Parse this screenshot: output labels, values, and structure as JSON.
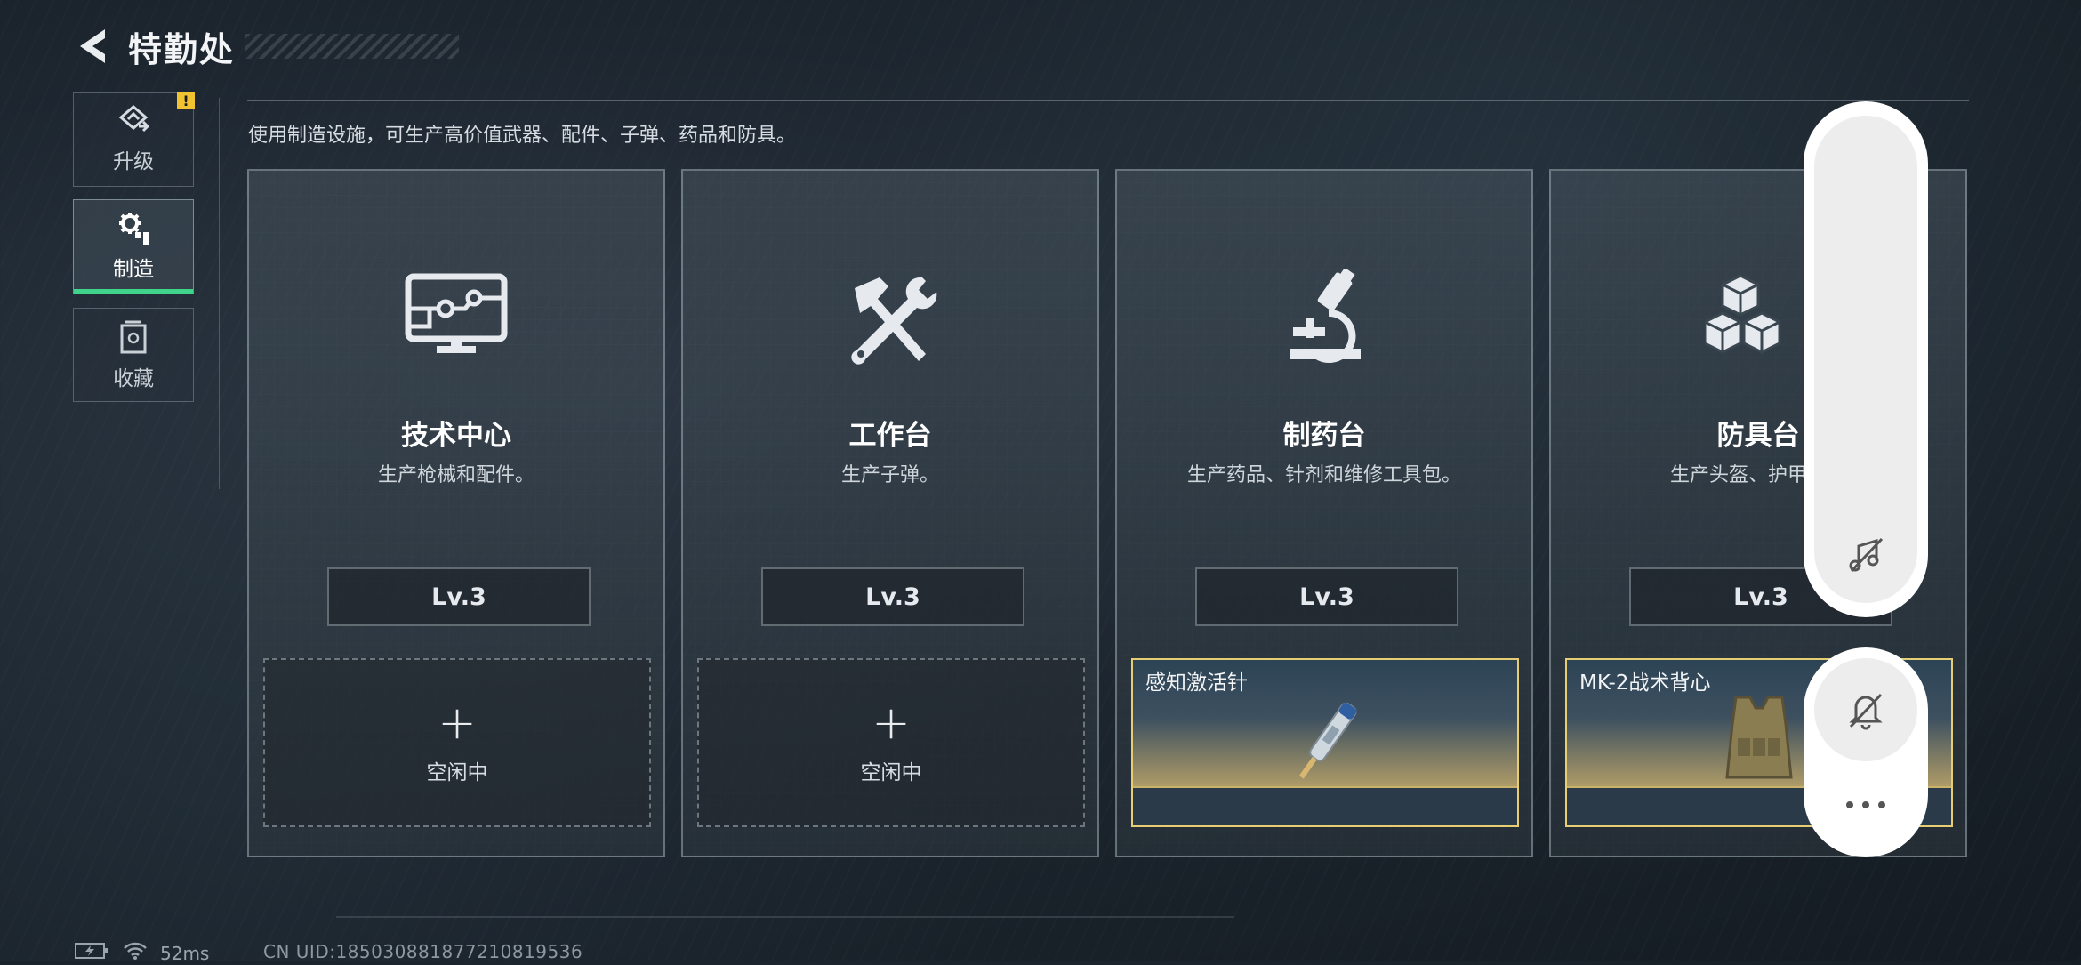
{
  "header": {
    "title": "特勤处"
  },
  "sidebar": {
    "items": [
      {
        "label": "升级",
        "icon": "upgrade-icon",
        "active": false,
        "badge": "!"
      },
      {
        "label": "制造",
        "icon": "manufacture-gear-icon",
        "active": true
      },
      {
        "label": "收藏",
        "icon": "collection-icon",
        "active": false
      }
    ]
  },
  "description": "使用制造设施，可生产高价值武器、配件、子弹、药品和防具。",
  "cards": [
    {
      "name": "技术中心",
      "sub": "生产枪械和配件。",
      "level": "Lv.3",
      "icon": "monitor-circuit-icon",
      "slot": {
        "type": "empty",
        "label": "空闲中"
      }
    },
    {
      "name": "工作台",
      "sub": "生产子弹。",
      "level": "Lv.3",
      "icon": "hammer-wrench-icon",
      "slot": {
        "type": "empty",
        "label": "空闲中"
      }
    },
    {
      "name": "制药台",
      "sub": "生产药品、针剂和维修工具包。",
      "level": "Lv.3",
      "icon": "microscope-icon",
      "slot": {
        "type": "item",
        "name": "感知激活针"
      }
    },
    {
      "name": "防具台",
      "sub": "生产头盔、护甲、胸",
      "level": "Lv.3",
      "icon": "cubes-icon",
      "slot": {
        "type": "item",
        "name": "MK-2战术背心"
      }
    }
  ],
  "status": {
    "ping": "52ms",
    "uid": "CN UID:185030881877210819536"
  },
  "colors": {
    "accent": "#3fd38c",
    "warning": "#f2c330",
    "item_border": "#e7cd74"
  }
}
